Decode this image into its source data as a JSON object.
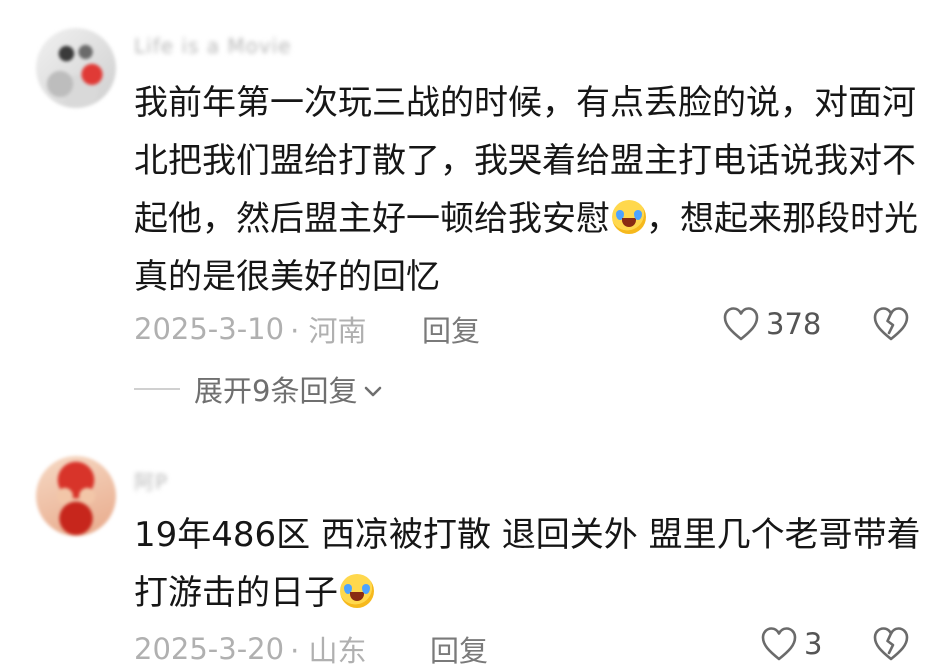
{
  "comments": [
    {
      "username": "Life is a Movie",
      "text_before_emoji": "我前年第一次玩三战的时候，有点丢脸的说，对面河北把我们盟给打散了，我哭着给盟主打电话说我对不起他，然后盟主好一顿给我安慰",
      "text_after_emoji": "，想起来那段时光真的是很美好的回忆",
      "emoji": "laughing-crying-emoji",
      "date": "2025-3-10",
      "location": "· 河南",
      "reply_label": "回复",
      "likes": "378",
      "expand_label": "展开9条回复"
    },
    {
      "username": "阿P",
      "text_before_emoji": "19年486区 西凉被打散 退回关外 盟里几个老哥带着打游击的日子",
      "text_after_emoji": "",
      "emoji": "crying-emoji",
      "date": "2025-3-20",
      "location": "· 山东",
      "reply_label": "回复",
      "likes": "3"
    }
  ],
  "colors": {
    "meta_text": "#b0b0b0",
    "body_text": "#161616"
  }
}
